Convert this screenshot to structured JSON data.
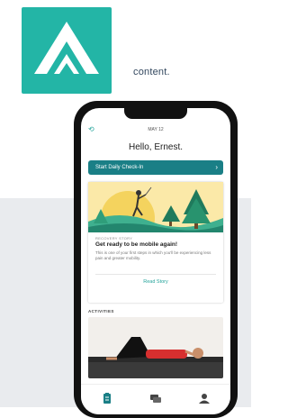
{
  "brand": {
    "tagline": "content."
  },
  "phone": {
    "date": "MAY 12",
    "greeting": "Hello, Ernest.",
    "checkin_label": "Start Daily Check-In",
    "story": {
      "kicker": "RECOVERY STORY",
      "title": "Get ready to be mobile again!",
      "body": "This is one of your first steps in which you'll be experiencing less pain and greater mobility.",
      "cta": "Read Story"
    },
    "section_label": "ACTIVITIES",
    "tabs": [
      {
        "icon": "clipboard-icon"
      },
      {
        "icon": "chat-icon"
      },
      {
        "icon": "person-icon"
      }
    ]
  },
  "colors": {
    "brand_teal": "#23b5a6",
    "button_teal": "#1a7f86",
    "background_gray": "#e9ebee"
  }
}
